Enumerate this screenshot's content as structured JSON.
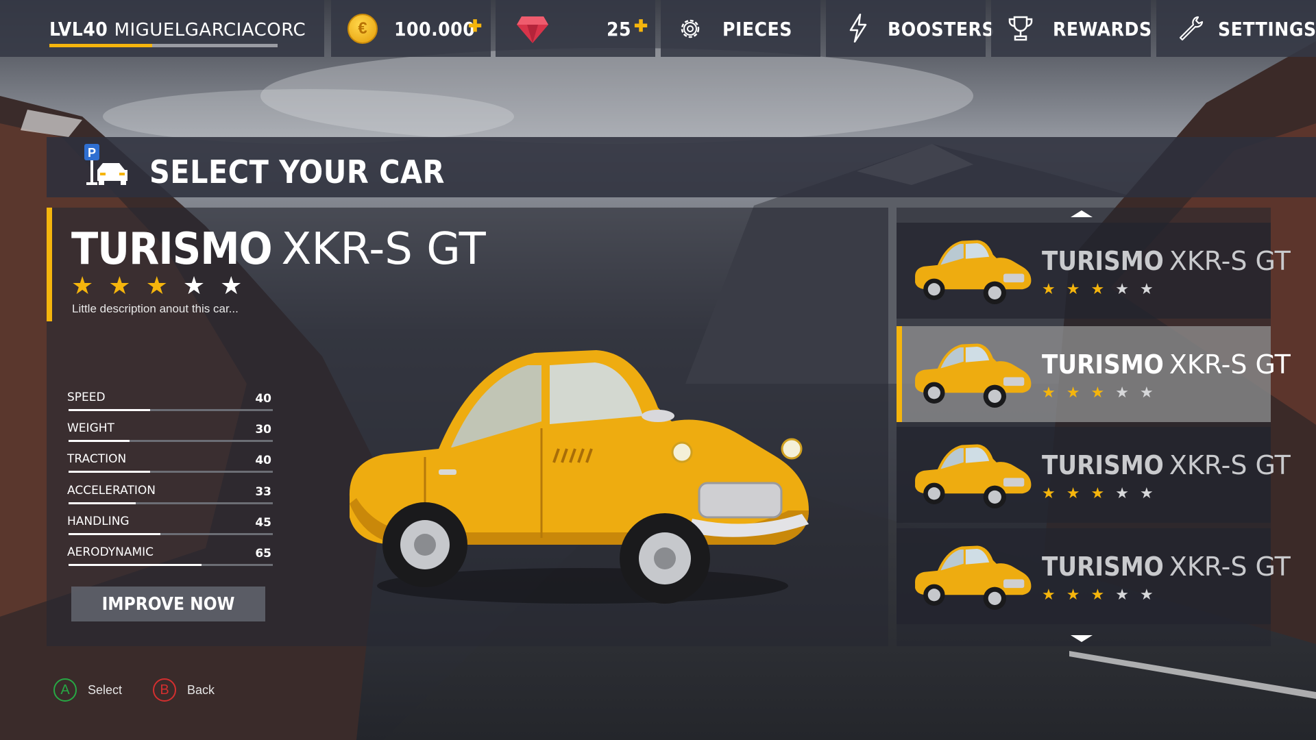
{
  "player": {
    "level_label": "LVL40",
    "username": "MIGUELGARCIACORC",
    "level_progress": 0.45
  },
  "currency": {
    "coins": "100.000",
    "coin_symbol": "€",
    "gems": "25",
    "plus_symbol": "✚"
  },
  "nav": {
    "pieces": "PIECES",
    "boosters": "BOOSTERS",
    "rewards": "REWARDS",
    "settings": "SETTINGS"
  },
  "screen_title": "SELECT YOUR CAR",
  "parking_badge": "P",
  "selected_car": {
    "brand": "TURISMO",
    "model": "XKR-S GT",
    "rating": 3,
    "max_rating": 5,
    "description": "Little description anout this car...",
    "stats": [
      {
        "label": "SPEED",
        "value": 40
      },
      {
        "label": "WEIGHT",
        "value": 30
      },
      {
        "label": "TRACTION",
        "value": 40
      },
      {
        "label": "ACCELERATION",
        "value": 33
      },
      {
        "label": "HANDLING",
        "value": 45
      },
      {
        "label": "AERODYNAMIC",
        "value": 65
      }
    ],
    "improve_label": "IMPROVE NOW"
  },
  "car_list": [
    {
      "brand": "TURISMO",
      "model": "XKR-S GT",
      "rating": 3,
      "selected": false
    },
    {
      "brand": "TURISMO",
      "model": "XKR-S GT",
      "rating": 3,
      "selected": true
    },
    {
      "brand": "TURISMO",
      "model": "XKR-S GT",
      "rating": 3,
      "selected": false
    },
    {
      "brand": "TURISMO",
      "model": "XKR-S GT",
      "rating": 3,
      "selected": false
    }
  ],
  "hints": [
    {
      "button": "A",
      "label": "Select",
      "color": "#27a844"
    },
    {
      "button": "B",
      "label": "Back",
      "color": "#d32f2f"
    }
  ],
  "colors": {
    "accent": "#f5b50d",
    "panel": "#343844"
  }
}
